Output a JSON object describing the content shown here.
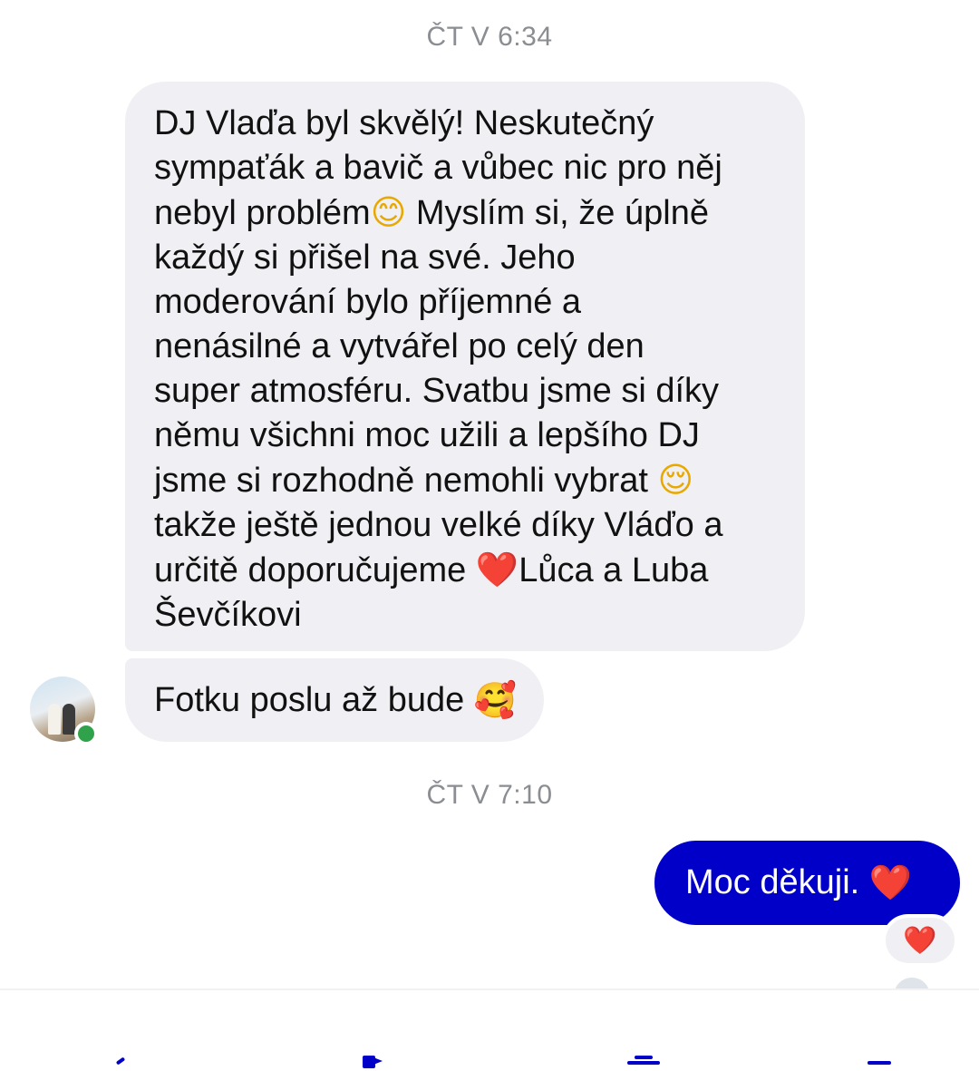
{
  "timestamps": {
    "first": "ČT V 6:34",
    "second": "ČT V 7:10"
  },
  "incoming_message_1": {
    "lines": [
      "DJ Vlaďa byl skvělý! Neskutečný",
      "sympaťák a bavič a vůbec nic pro něj",
      "nebyl problém",
      "Myslím si, že úplně",
      "každý si přišel na své. Jeho",
      "moderování bylo příjemné a",
      "nenásilné a vytvářel po celý den",
      "super atmosféru. Svatbu jsme si díky",
      "němu všichni moc užili a lepšího DJ",
      "jsme si rozhodně nemohli vybrat",
      "takže ještě jednou velké díky Vláďo a",
      "určitě doporučujeme",
      "Lůca a Luba",
      "Ševčíkovi"
    ],
    "emoji_smile": "😊",
    "emoji_relieved": "😌",
    "emoji_heart": "❤️"
  },
  "incoming_message_2": {
    "text": "Fotku poslu až bude",
    "emoji": "🥰"
  },
  "outgoing_message": {
    "text": "Moc děkuji.",
    "emoji": "❤️"
  },
  "reaction": {
    "emoji": "❤️"
  },
  "colors": {
    "outgoing_bubble": "#0000c8",
    "incoming_bubble": "#f0f0f4",
    "online_status": "#31a24c",
    "timestamp_text": "#8a8d91"
  },
  "icons": [
    "contact-avatar",
    "online-status",
    "reaction-heart",
    "seen-avatar",
    "bottom-bar-icons"
  ]
}
